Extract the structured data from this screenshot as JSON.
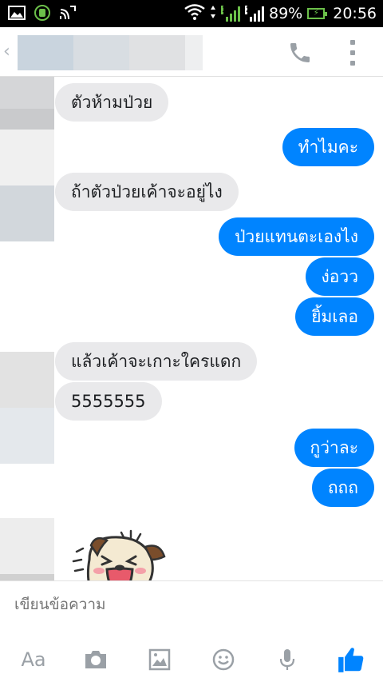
{
  "status_bar": {
    "battery": "89%",
    "time": "20:56",
    "sim1": "1",
    "sim2": "2"
  },
  "header": {
    "back_icon": "chevron-left-icon",
    "call_icon": "phone-icon",
    "more_icon": "more-vertical-icon"
  },
  "messages": [
    {
      "side": "in",
      "text": "ตัวห้ามป่วย"
    },
    {
      "side": "out",
      "text": "ทำไมคะ"
    },
    {
      "side": "in",
      "text": "ถ้าตัวป่วยเค้าจะอยู่ไง"
    },
    {
      "side": "out",
      "text": "ป่วยแทนตะเองไง"
    },
    {
      "side": "out",
      "text": "ง่อวว"
    },
    {
      "side": "out",
      "text": "ยิ้มเลอ"
    },
    {
      "side": "in",
      "text": "แล้วเค้าจะเกาะใครแดก"
    },
    {
      "side": "in",
      "text": "5555555"
    },
    {
      "side": "out",
      "text": "กูว่าละ"
    },
    {
      "side": "out",
      "text": "ถถถ"
    }
  ],
  "composer": {
    "placeholder": "เขียนข้อความ",
    "aa_label": "Aa",
    "icons": [
      "text-format-icon",
      "camera-icon",
      "image-icon",
      "emoji-icon",
      "microphone-icon",
      "thumbs-up-icon"
    ]
  },
  "colors": {
    "outgoing": "#0084ff",
    "incoming": "#e9e9eb",
    "accent": "#0084ff"
  }
}
